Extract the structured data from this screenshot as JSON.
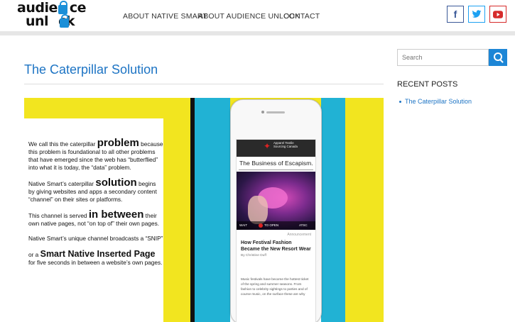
{
  "header": {
    "logo_line1": "audie",
    "logo_line1b": "ce",
    "logo_line2": "unl",
    "logo_line2b": "ck",
    "nav": [
      "ABOUT NATIVE SMART",
      "ABOUT AUDIENCE UNLOCK",
      "CONTACT"
    ],
    "social": {
      "facebook": "facebook-icon",
      "twitter": "twitter-icon",
      "youtube": "youtube-icon"
    }
  },
  "post": {
    "title": "The Caterpillar Solution"
  },
  "hero": {
    "colors": {
      "yellow": "#f2e51f",
      "cyan": "#21b2d4",
      "black": "#111111"
    },
    "p1_a": "We call this the caterpillar ",
    "p1_b": "problem",
    "p1_c": " because this problem is foundational to all other problems that have emerged since the web has “butterflied” into what it is today, the “data” problem.",
    "p2_a": "Native Smart’s caterpillar ",
    "p2_b": "solution",
    "p2_c": " begins by giving websites and apps a secondary content “channel” on their sites or platforms.",
    "p3_a": "This channel is served ",
    "p3_b": "in between",
    "p3_c": " their own native pages, not “on top of” their own pages.",
    "p4": "Native Smart’s unique channel broadcasts a “SNIP”",
    "p5_a": "or a ",
    "p5_b": "Smart Native Inserted Page",
    "p5_c": " for five seconds in between a website’s own pages.",
    "phone": {
      "app_name": "Apparel Textile Sourcing Canada",
      "heading": "The Business of Escapism.",
      "wait": "WAIT",
      "open": "TO OPEN",
      "brand": "ATSC",
      "tag": "Announcement",
      "headline": "How Festival Fashion Became the New Resort Wear",
      "byline": "By Christine Duff",
      "body": "Music festivals have become the hottest ticket of the spring and summer seasons. From fashion to celebrity sightings to parties and of course music, on the surface these are why"
    }
  },
  "sidebar": {
    "search_placeholder": "Search",
    "recent_title": "RECENT POSTS",
    "recent_posts": [
      "The Caterpillar Solution"
    ]
  }
}
